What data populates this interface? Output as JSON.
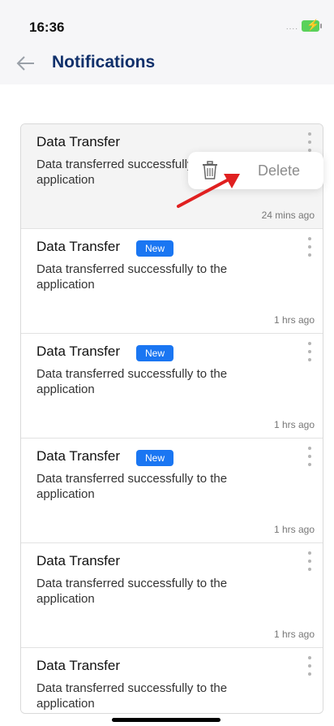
{
  "status_bar": {
    "time": "16:36",
    "signal": "....",
    "battery_icon": "battery-charging-icon"
  },
  "nav": {
    "back_icon": "back-arrow-icon",
    "title": "Notifications"
  },
  "notifications": [
    {
      "title": "Data Transfer",
      "badge": "",
      "body": "Data transferred successfully to the application",
      "time": "24 mins ago"
    },
    {
      "title": "Data Transfer",
      "badge": "New",
      "body": "Data transferred successfully to the application",
      "time": "1 hrs ago"
    },
    {
      "title": "Data Transfer",
      "badge": "New",
      "body": "Data transferred successfully to the application",
      "time": "1 hrs ago"
    },
    {
      "title": "Data Transfer",
      "badge": "New",
      "body": "Data transferred successfully to the application",
      "time": "1 hrs ago"
    },
    {
      "title": "Data Transfer",
      "badge": "",
      "body": "Data transferred successfully to the application",
      "time": "1 hrs ago"
    },
    {
      "title": "Data Transfer",
      "badge": "",
      "body": "Data transferred successfully to the application",
      "time": ""
    }
  ],
  "context_menu": {
    "icon": "trash-icon",
    "label": "Delete"
  },
  "colors": {
    "accent": "#1a76f2",
    "title": "#10306b",
    "arrow": "#e02020"
  }
}
